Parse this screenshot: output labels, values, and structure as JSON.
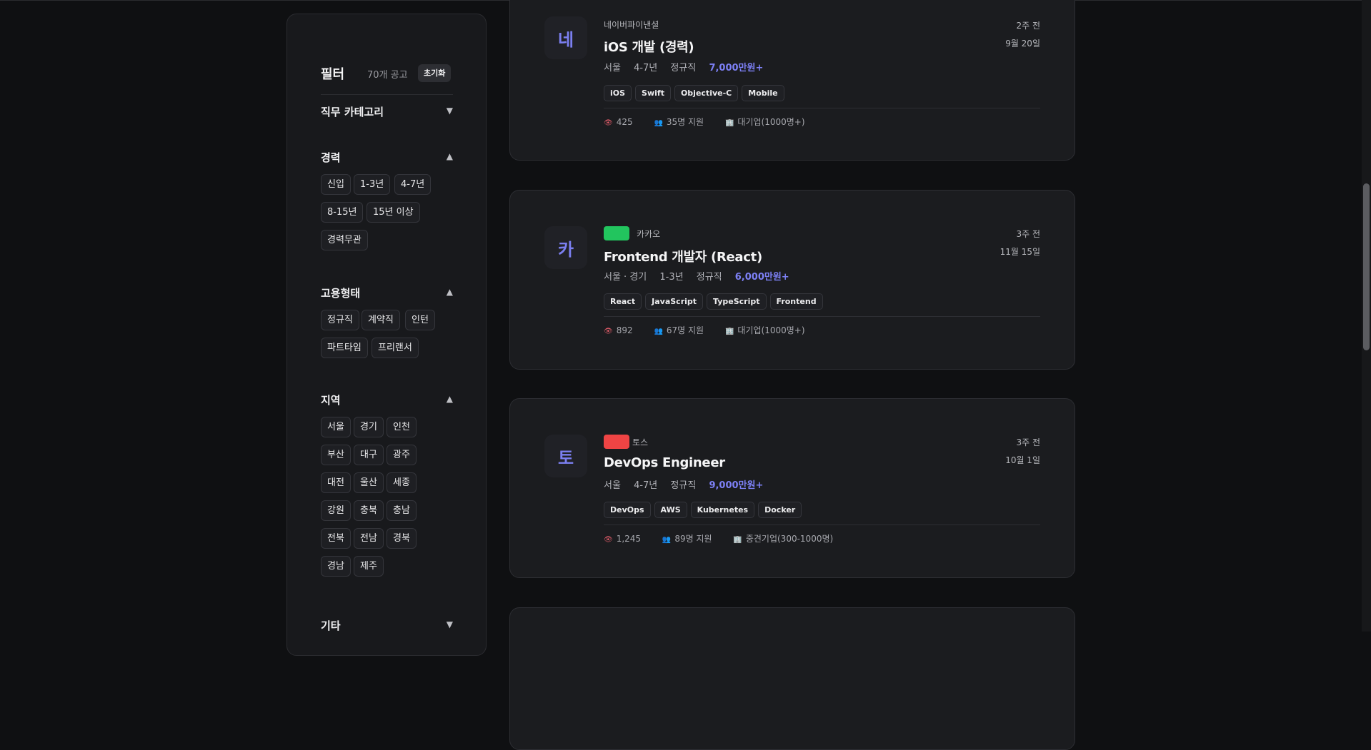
{
  "filter": {
    "title": "필터",
    "count": "70개 공고",
    "reset_label": "초기화",
    "sections": [
      {
        "title": "직무 카테고리",
        "arrow": "▼",
        "chips": []
      },
      {
        "title": "경력",
        "arrow": "▲",
        "chips": [
          "신입",
          "1-3년",
          "4-7년",
          "8-15년",
          "15년 이상",
          "경력무관"
        ]
      },
      {
        "title": "고용형태",
        "arrow": "▲",
        "chips": [
          "정규직",
          "계약직",
          "인턴",
          "파트타임",
          "프리랜서"
        ]
      },
      {
        "title": "지역",
        "arrow": "▲",
        "chips": [
          "서울",
          "경기",
          "인천",
          "부산",
          "대구",
          "광주",
          "대전",
          "울산",
          "세종",
          "강원",
          "충북",
          "충남",
          "전북",
          "전남",
          "경북",
          "경남",
          "제주"
        ]
      },
      {
        "title": "기타",
        "arrow": "▼",
        "chips": []
      }
    ]
  },
  "jobs": [
    {
      "logo_letter": "네",
      "company": "네이버파이낸셜",
      "badge_color": "",
      "title": "iOS 개발 (경력)",
      "location": "서울",
      "experience": "4-7년",
      "employment": "정규직",
      "salary": "7,000만원+",
      "posted": "2주 전",
      "deadline": "9월 20일",
      "tags": [
        "iOS",
        "Swift",
        "Objective-C",
        "Mobile"
      ],
      "views": "425",
      "applicants": "35명 지원",
      "company_size": "대기업(1000명+)"
    },
    {
      "logo_letter": "카",
      "company": "카카오",
      "badge_color": "#22c55e",
      "title": "Frontend 개발자 (React)",
      "location": "서울 · 경기",
      "experience": "1-3년",
      "employment": "정규직",
      "salary": "6,000만원+",
      "posted": "3주 전",
      "deadline": "11월 15일",
      "tags": [
        "React",
        "JavaScript",
        "TypeScript",
        "Frontend"
      ],
      "views": "892",
      "applicants": "67명 지원",
      "company_size": "대기업(1000명+)"
    },
    {
      "logo_letter": "토",
      "company": "토스",
      "badge_color": "#ef4444",
      "title": "DevOps Engineer",
      "location": "서울",
      "experience": "4-7년",
      "employment": "정규직",
      "salary": "9,000만원+",
      "posted": "3주 전",
      "deadline": "10월 1일",
      "tags": [
        "DevOps",
        "AWS",
        "Kubernetes",
        "Docker"
      ],
      "views": "1,245",
      "applicants": "89명 지원",
      "company_size": "중견기업(300-1000명)"
    }
  ],
  "icons": {
    "views": "eye-icon",
    "applicants": "people-icon",
    "company_size": "building-icon"
  },
  "colors": {
    "accent": "#7d80f6",
    "background": "#0f1012",
    "card": "#1b1c1f"
  }
}
